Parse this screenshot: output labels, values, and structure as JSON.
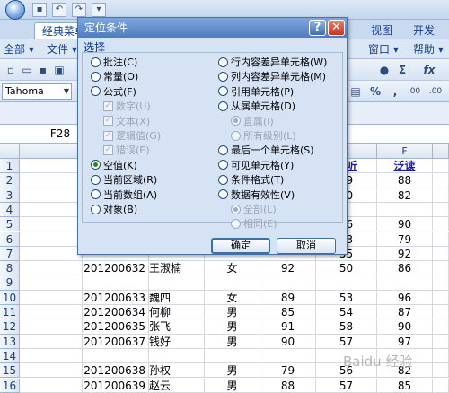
{
  "window": {
    "tabs": [
      "经典菜单",
      "视图",
      "开发工具"
    ],
    "menu": [
      "全部",
      "文件",
      "窗口",
      "帮助"
    ]
  },
  "toolbar": {
    "font_name": "Tahoma",
    "percent_symbol": "%",
    "comma_symbol": ",",
    "inc_decimal": ".00",
    "dec_decimal": ".00",
    "sigma_symbol": "Σ",
    "fx_symbol": "fx"
  },
  "formula_bar": {
    "name_box": "F28"
  },
  "grid": {
    "col_headers": [
      "E",
      "F"
    ],
    "header_row": {
      "e": "视听",
      "f": "泛读",
      "left_frag": "学"
    },
    "rows": [
      {
        "n": "1",
        "id": "",
        "name": "",
        "sex": "",
        "d": "",
        "e": "",
        "f": ""
      },
      {
        "n": "2",
        "id": "",
        "name": "",
        "sex": "",
        "d": "",
        "e": "49",
        "f": "88"
      },
      {
        "n": "3",
        "id": "",
        "name": "",
        "sex": "",
        "d": "",
        "e": "60",
        "f": "82"
      },
      {
        "n": "4",
        "id": "",
        "name": "",
        "sex": "",
        "d": "",
        "e": "",
        "f": ""
      },
      {
        "n": "5",
        "id": "",
        "name": "",
        "sex": "",
        "d": "",
        "e": "56",
        "f": "90"
      },
      {
        "n": "6",
        "id": "",
        "name": "",
        "sex": "",
        "d": "",
        "e": "63",
        "f": "79"
      },
      {
        "n": "7",
        "id": "",
        "name": "",
        "sex": "",
        "d": "",
        "e": "55",
        "f": "92"
      },
      {
        "n": "8",
        "id": "201200632",
        "name": "王淑楠",
        "sex": "女",
        "d": "92",
        "e": "50",
        "f": "86"
      },
      {
        "n": "9",
        "id": "",
        "name": "",
        "sex": "",
        "d": "",
        "e": "",
        "f": ""
      },
      {
        "n": "10",
        "id": "201200633",
        "name": "魏四",
        "sex": "女",
        "d": "89",
        "e": "53",
        "f": "96"
      },
      {
        "n": "11",
        "id": "201200634",
        "name": "何柳",
        "sex": "男",
        "d": "85",
        "e": "54",
        "f": "87"
      },
      {
        "n": "12",
        "id": "201200635",
        "name": "张飞",
        "sex": "男",
        "d": "91",
        "e": "58",
        "f": "90"
      },
      {
        "n": "13",
        "id": "201200637",
        "name": "钱好",
        "sex": "男",
        "d": "90",
        "e": "57",
        "f": "97"
      },
      {
        "n": "14",
        "id": "",
        "name": "",
        "sex": "",
        "d": "",
        "e": "",
        "f": ""
      },
      {
        "n": "15",
        "id": "201200638",
        "name": "孙权",
        "sex": "男",
        "d": "79",
        "e": "56",
        "f": "82"
      },
      {
        "n": "16",
        "id": "201200639",
        "name": "赵云",
        "sex": "男",
        "d": "88",
        "e": "57",
        "f": "85"
      }
    ]
  },
  "dialog": {
    "title": "定位条件",
    "help_label": "?",
    "close_label": "✕",
    "group_label": "选择",
    "left_options": [
      {
        "label": "批注(C)",
        "type": "radio",
        "selected": false,
        "disabled": false
      },
      {
        "label": "常量(O)",
        "type": "radio",
        "selected": false,
        "disabled": false
      },
      {
        "label": "公式(F)",
        "type": "radio",
        "selected": false,
        "disabled": false
      },
      {
        "label": "数字(U)",
        "type": "check",
        "selected": true,
        "disabled": true
      },
      {
        "label": "文本(X)",
        "type": "check",
        "selected": true,
        "disabled": true
      },
      {
        "label": "逻辑值(G)",
        "type": "check",
        "selected": true,
        "disabled": true
      },
      {
        "label": "错误(E)",
        "type": "check",
        "selected": true,
        "disabled": true
      },
      {
        "label": "空值(K)",
        "type": "radio",
        "selected": true,
        "disabled": false
      },
      {
        "label": "当前区域(R)",
        "type": "radio",
        "selected": false,
        "disabled": false
      },
      {
        "label": "当前数组(A)",
        "type": "radio",
        "selected": false,
        "disabled": false
      },
      {
        "label": "对象(B)",
        "type": "radio",
        "selected": false,
        "disabled": false
      }
    ],
    "right_options": [
      {
        "label": "行内容差异单元格(W)",
        "type": "radio",
        "selected": false,
        "disabled": false
      },
      {
        "label": "列内容差异单元格(M)",
        "type": "radio",
        "selected": false,
        "disabled": false
      },
      {
        "label": "引用单元格(P)",
        "type": "radio",
        "selected": false,
        "disabled": false
      },
      {
        "label": "从属单元格(D)",
        "type": "radio",
        "selected": false,
        "disabled": false
      },
      {
        "label": "直属(I)",
        "type": "radio",
        "selected": true,
        "disabled": true
      },
      {
        "label": "所有级别(L)",
        "type": "radio",
        "selected": false,
        "disabled": true
      },
      {
        "label": "最后一个单元格(S)",
        "type": "radio",
        "selected": false,
        "disabled": false
      },
      {
        "label": "可见单元格(Y)",
        "type": "radio",
        "selected": false,
        "disabled": false
      },
      {
        "label": "条件格式(T)",
        "type": "radio",
        "selected": false,
        "disabled": false
      },
      {
        "label": "数据有效性(V)",
        "type": "radio",
        "selected": false,
        "disabled": false
      },
      {
        "label": "全部(L)",
        "type": "radio",
        "selected": true,
        "disabled": true
      },
      {
        "label": "相同(E)",
        "type": "radio",
        "selected": false,
        "disabled": true
      }
    ],
    "ok_label": "确定",
    "cancel_label": "取消"
  },
  "watermark": "Baidu 经验"
}
